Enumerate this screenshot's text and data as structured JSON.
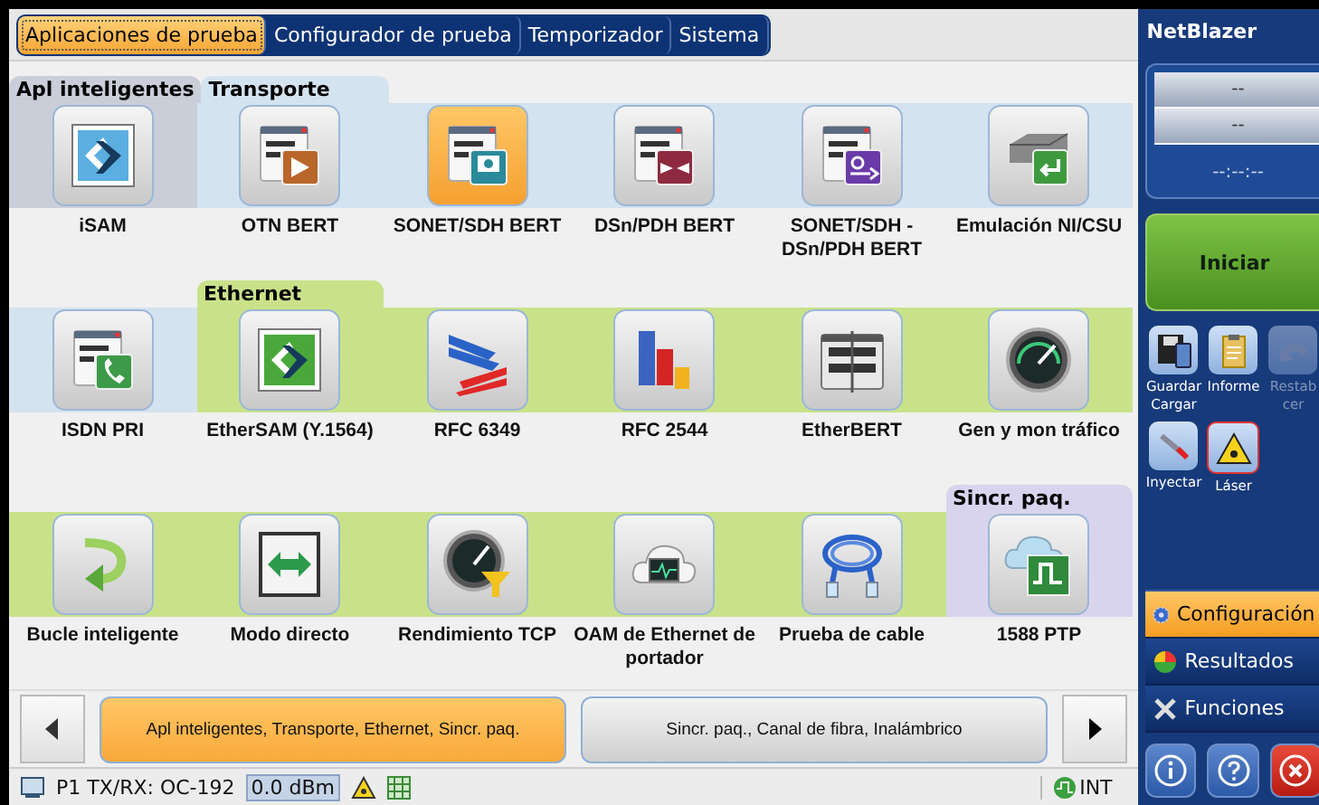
{
  "tabs": [
    {
      "label": "Aplicaciones de prueba",
      "selected": true
    },
    {
      "label": "Configurador de prueba",
      "selected": false
    },
    {
      "label": "Temporizador",
      "selected": false
    },
    {
      "label": "Sistema",
      "selected": false
    }
  ],
  "rows": [
    {
      "cells": [
        {
          "label": "iSAM",
          "kind": "chevron",
          "color": "#c9ced8",
          "section_title": "Apl inteligentes",
          "selected": false
        },
        {
          "label": "OTN BERT",
          "kind": "binary-play",
          "color": "#d4e3f0",
          "section_title": "Transporte",
          "selected": false
        },
        {
          "label": "SONET/SDH BERT",
          "kind": "binary-screen",
          "color": "#d4e3f0",
          "selected": true
        },
        {
          "label": "DSn/PDH BERT",
          "kind": "binary-merge",
          "color": "#d4e3f0",
          "selected": false
        },
        {
          "label": "SONET/SDH - DSn/PDH BERT",
          "kind": "binary-loop",
          "color": "#d4e3f0",
          "selected": false
        },
        {
          "label": "Emulación NI/CSU",
          "kind": "drive",
          "color": "#d4e3f0",
          "selected": false
        }
      ]
    },
    {
      "cells": [
        {
          "label": "ISDN PRI",
          "kind": "binary-phone",
          "color": "#d4e3f0",
          "selected": false
        },
        {
          "label": "EtherSAM (Y.1564)",
          "kind": "chevron-green",
          "color": "#c9e28a",
          "section_title": "Ethernet",
          "selected": false
        },
        {
          "label": "RFC 6349",
          "kind": "arrows",
          "color": "#c9e28a",
          "selected": false
        },
        {
          "label": "RFC 2544",
          "kind": "bars",
          "color": "#c9e28a",
          "selected": false
        },
        {
          "label": "EtherBERT",
          "kind": "binary-board",
          "color": "#c9e28a",
          "selected": false
        },
        {
          "label": "Gen y mon tráfico",
          "kind": "gauge",
          "color": "#c9e28a",
          "selected": false
        }
      ]
    },
    {
      "cells": [
        {
          "label": "Bucle inteligente",
          "kind": "curved-arrow",
          "color": "#c9e28a",
          "selected": false
        },
        {
          "label": "Modo directo",
          "kind": "double-arrow",
          "color": "#c9e28a",
          "selected": false
        },
        {
          "label": "Rendimiento TCP",
          "kind": "gauge-funnel",
          "color": "#c9e28a",
          "selected": false
        },
        {
          "label": "OAM de Ethernet de portador",
          "kind": "cloud-monitor",
          "color": "#c9e28a",
          "selected": false
        },
        {
          "label": "Prueba de cable",
          "kind": "cable",
          "color": "#c9e28a",
          "selected": false
        },
        {
          "label": "1588 PTP",
          "kind": "cloud-wave",
          "color": "#d9d4ee",
          "section_title": "Sincr. paq.",
          "selected": false
        }
      ]
    }
  ],
  "pager": {
    "pages": [
      {
        "label": "Apl inteligentes, Transporte, Ethernet, Sincr. paq.",
        "selected": true
      },
      {
        "label": "Sincr. paq., Canal de fibra, Inalámbrico",
        "selected": false
      }
    ]
  },
  "status_bar": {
    "port": "P1 TX/RX: OC-192",
    "power": "0.0 dBm",
    "clock": "INT"
  },
  "sidebar": {
    "title": "NetBlazer",
    "readouts": [
      "--",
      "--"
    ],
    "timer": "--:--:--",
    "start": "Iniciar",
    "tools": [
      {
        "label": "Guardar Cargar",
        "kind": "save",
        "disabled": false
      },
      {
        "label": "Informe",
        "kind": "report",
        "disabled": false
      },
      {
        "label": "Restab cer",
        "kind": "undo",
        "disabled": true
      },
      {
        "label": "Inyectar",
        "kind": "inject",
        "disabled": false
      },
      {
        "label": "Láser",
        "kind": "laser",
        "disabled": false
      }
    ],
    "nav": [
      {
        "label": "Configuración",
        "kind": "gear",
        "selected": true
      },
      {
        "label": "Resultados",
        "kind": "pie",
        "selected": false
      },
      {
        "label": "Funciones",
        "kind": "tools",
        "selected": false
      }
    ]
  }
}
